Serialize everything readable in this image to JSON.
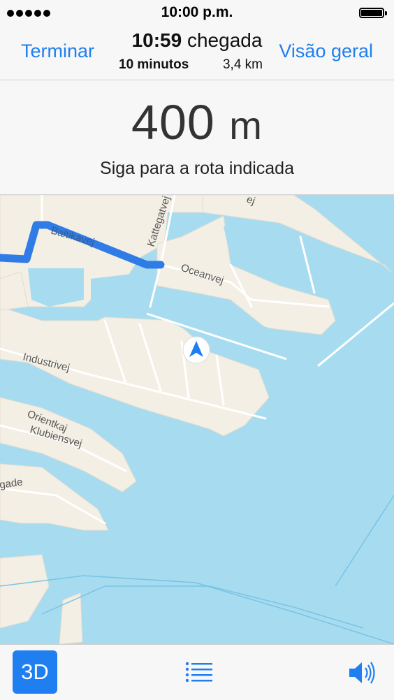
{
  "status_bar": {
    "time": "10:00 p.m.",
    "signal_icon": "signal-dots-icon",
    "battery_icon": "battery-icon"
  },
  "nav": {
    "left_button": "Terminar",
    "right_button": "Visão geral",
    "arrival_time": "10:59",
    "arrival_label": "chegada",
    "duration": "10 minutos",
    "distance": "3,4 km"
  },
  "instruction": {
    "distance_value": "400",
    "distance_unit": "m",
    "text": "Siga para a rota indicada"
  },
  "map": {
    "street_labels": {
      "baltikavej": "Baltikavej",
      "kattegatvej": "Kattegatvej",
      "oceanvej": "Oceanvej",
      "industrivej": "Industrivej",
      "orientkaj": "Orientkaj",
      "klubiensvej": "Klubiensvej",
      "gade": "gade",
      "top_fragment": "ej"
    },
    "colors": {
      "water": "#a7dcf0",
      "land": "#f4efe4",
      "road": "#ffffff",
      "route": "#2f7ce6",
      "accent": "#1f7ff0"
    },
    "location_icon": "navigation-arrow-icon"
  },
  "toolbar": {
    "view_mode_label": "3D",
    "list_icon": "list-icon",
    "volume_icon": "volume-icon"
  }
}
